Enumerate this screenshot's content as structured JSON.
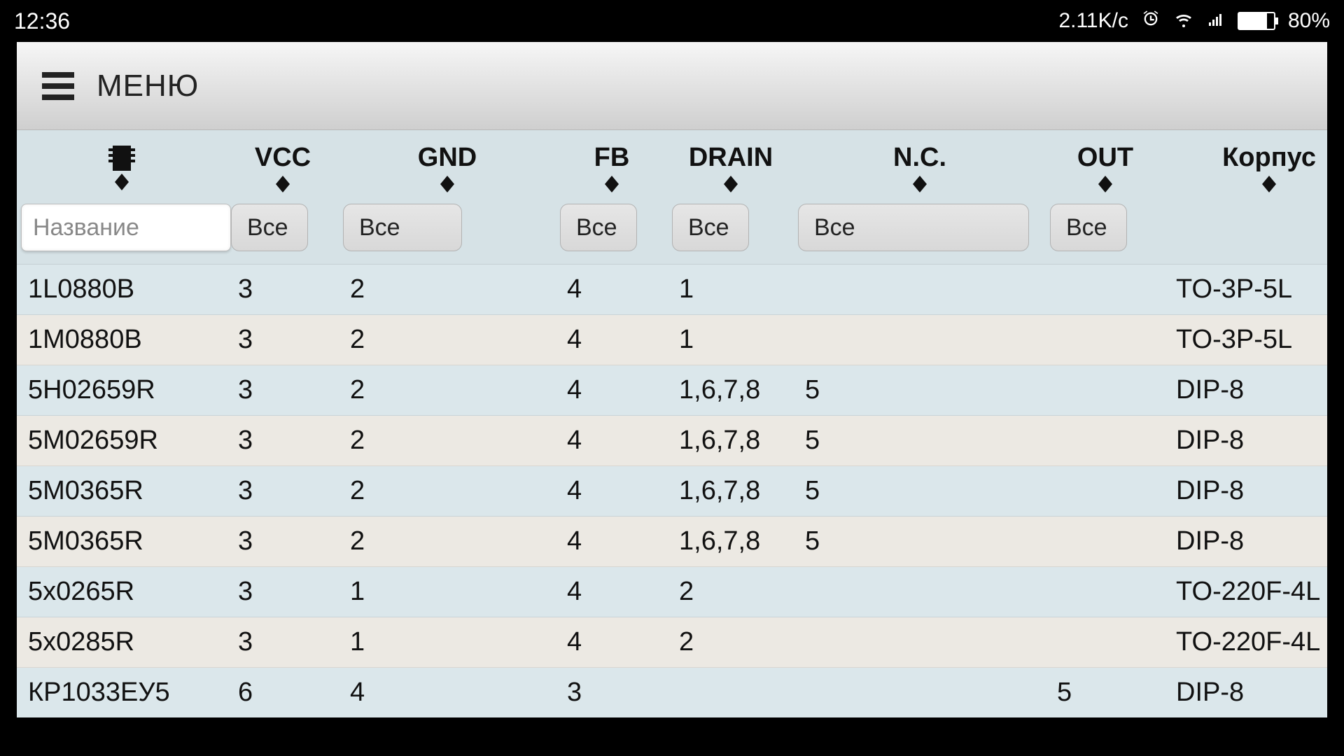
{
  "status_bar": {
    "time": "12:36",
    "speed": "2.11K/c",
    "battery_percent": "80%"
  },
  "toolbar": {
    "menu_label": "МЕНЮ"
  },
  "table": {
    "headers": {
      "vcc": "VCC",
      "gnd": "GND",
      "fb": "FB",
      "drain": "DRAIN",
      "nc": "N.C.",
      "out": "OUT",
      "pkg": "Корпус"
    },
    "filters": {
      "name_placeholder": "Название",
      "all_label": "Все"
    },
    "rows": [
      {
        "name": "1L0880B",
        "vcc": "3",
        "gnd": "2",
        "fb": "4",
        "drain": "1",
        "nc": "",
        "out": "",
        "pkg": "TO-3P-5L"
      },
      {
        "name": "1M0880B",
        "vcc": "3",
        "gnd": "2",
        "fb": "4",
        "drain": "1",
        "nc": "",
        "out": "",
        "pkg": "TO-3P-5L"
      },
      {
        "name": "5H02659R",
        "vcc": "3",
        "gnd": "2",
        "fb": "4",
        "drain": "1,6,7,8",
        "nc": "5",
        "out": "",
        "pkg": "DIP-8"
      },
      {
        "name": "5M02659R",
        "vcc": "3",
        "gnd": "2",
        "fb": "4",
        "drain": "1,6,7,8",
        "nc": "5",
        "out": "",
        "pkg": "DIP-8"
      },
      {
        "name": "5M0365R",
        "vcc": "3",
        "gnd": "2",
        "fb": "4",
        "drain": "1,6,7,8",
        "nc": "5",
        "out": "",
        "pkg": "DIP-8"
      },
      {
        "name": "5M0365R",
        "vcc": "3",
        "gnd": "2",
        "fb": "4",
        "drain": "1,6,7,8",
        "nc": "5",
        "out": "",
        "pkg": "DIP-8"
      },
      {
        "name": "5x0265R",
        "vcc": "3",
        "gnd": "1",
        "fb": "4",
        "drain": "2",
        "nc": "",
        "out": "",
        "pkg": "TO-220F-4L"
      },
      {
        "name": "5x0285R",
        "vcc": "3",
        "gnd": "1",
        "fb": "4",
        "drain": "2",
        "nc": "",
        "out": "",
        "pkg": "TO-220F-4L"
      },
      {
        "name": "КР1033ЕУ5",
        "vcc": "6",
        "gnd": "4",
        "fb": "3",
        "drain": "",
        "nc": "",
        "out": "5",
        "pkg": "DIP-8"
      }
    ]
  }
}
